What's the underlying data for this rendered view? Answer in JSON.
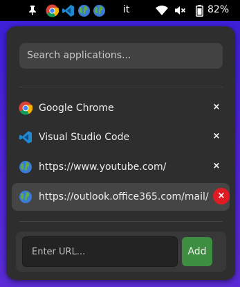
{
  "topbar": {
    "language": "it",
    "battery_percent": "82%",
    "icons": [
      "pin-icon",
      "chrome-icon",
      "vscode-icon",
      "globe-icon",
      "globe-icon",
      "wifi-icon",
      "volume-muted-icon",
      "battery-icon"
    ]
  },
  "popup": {
    "search_placeholder": "Search applications...",
    "items": [
      {
        "label": "Google Chrome",
        "icon": "chrome-icon",
        "close": "×"
      },
      {
        "label": "Visual Studio Code",
        "icon": "vscode-icon",
        "close": "×"
      },
      {
        "label": "https://www.youtube.com/",
        "icon": "globe-icon",
        "close": "×"
      },
      {
        "label": "https://outlook.office365.com/mail/",
        "icon": "globe-icon",
        "close": "×",
        "active": true
      }
    ],
    "url_placeholder": "Enter URL...",
    "add_label": "Add"
  },
  "colors": {
    "background": "#4b23d9",
    "panel": "#2e2e2e",
    "add_button": "#3e8e41",
    "danger": "#e01b24"
  }
}
